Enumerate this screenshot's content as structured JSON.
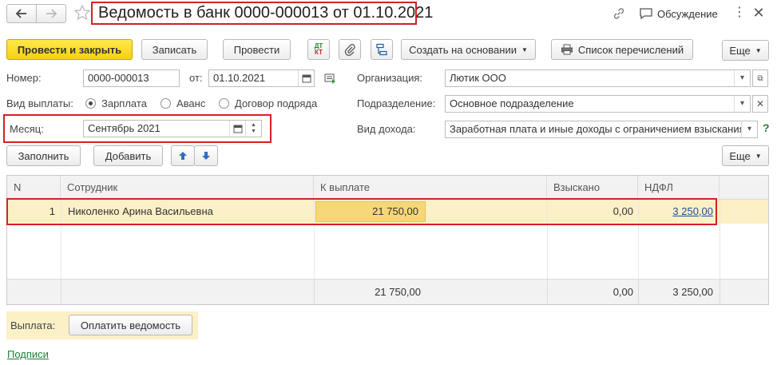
{
  "window": {
    "title": "Ведомость в банк 0000-000013 от 01.10.2021",
    "discussion_label": "Обсуждение"
  },
  "toolbar": {
    "post_and_close": "Провести и закрыть",
    "save": "Записать",
    "post": "Провести",
    "create_based_on": "Создать на основании",
    "transfer_list": "Список перечислений",
    "more": "Еще",
    "dt_kt_top": "ДТ",
    "dt_kt_bottom": "КТ"
  },
  "form": {
    "number_label": "Номер:",
    "number_value": "0000-000013",
    "from_label": "от:",
    "date_value": "01.10.2021",
    "org_label": "Организация:",
    "org_value": "Лютик ООО",
    "pay_type_label": "Вид выплаты:",
    "pay_options": [
      "Зарплата",
      "Аванс",
      "Договор подряда"
    ],
    "pay_selected": 0,
    "dept_label": "Подразделение:",
    "dept_value": "Основное подразделение",
    "month_label": "Месяц:",
    "month_value": "Сентябрь 2021",
    "income_label": "Вид дохода:",
    "income_value": "Заработная плата и иные доходы с ограничением взыскания"
  },
  "table_toolbar": {
    "fill": "Заполнить",
    "add": "Добавить",
    "more": "Еще"
  },
  "table": {
    "columns": [
      "N",
      "Сотрудник",
      "К выплате",
      "Взыскано",
      "НДФЛ"
    ],
    "rows": [
      {
        "n": "1",
        "employee": "Николенко Арина Васильевна",
        "to_pay": "21 750,00",
        "recovered": "0,00",
        "ndfl": "3 250,00"
      }
    ],
    "totals": {
      "to_pay": "21 750,00",
      "recovered": "0,00",
      "ndfl": "3 250,00"
    }
  },
  "footer": {
    "payment_label": "Выплата:",
    "pay_statement_button": "Оплатить ведомость",
    "signatures_link": "Подписи"
  }
}
